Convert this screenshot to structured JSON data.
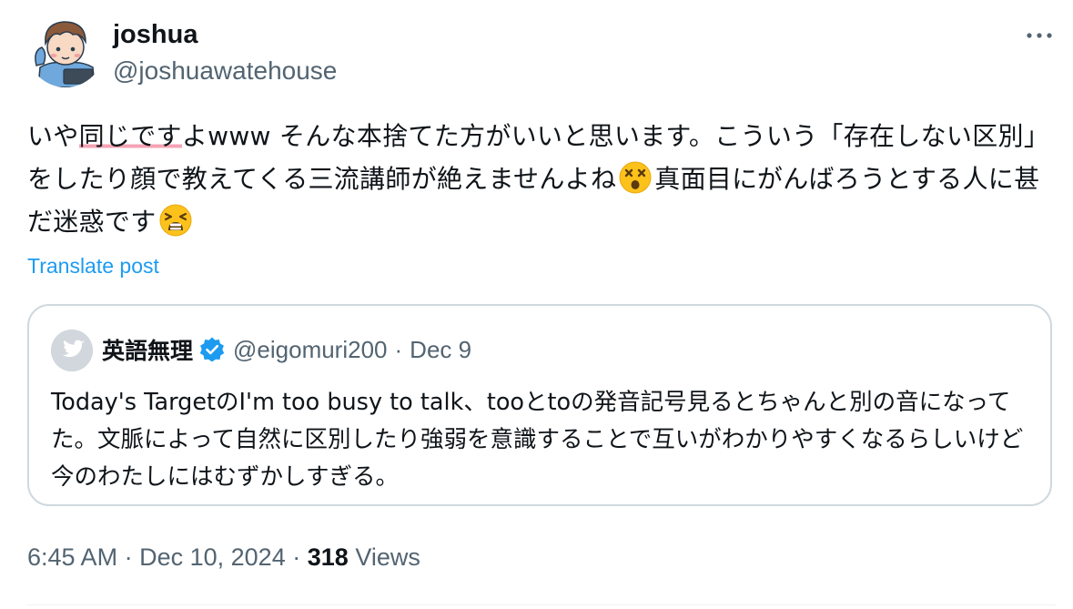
{
  "author": {
    "display_name": "joshua",
    "handle": "@joshuawatehouse",
    "avatar_icon": "cartoon-boy-avatar-icon"
  },
  "more_icon": "more-horizontal-icon",
  "tweet": {
    "text_1": "いや",
    "text_highlight": "同じです",
    "text_2": "よwww そんな本捨てた方がいいと思います。こういう「存在しない区別」をしたり顔で教えてくる三流講師が絶えませんよね",
    "emoji_1": "dizzy-face-emoji",
    "text_3": "真面目にがんばろうとする人に甚だ迷惑です",
    "emoji_2": "weary-face-emoji",
    "highlight_color": "#f4a3b4"
  },
  "translate_label": "Translate post",
  "quote": {
    "name": "英語無理",
    "verified_icon": "verified-badge-icon",
    "handle": "@eigomuri200",
    "separator": "·",
    "date": "Dec 9",
    "text": "Today's TargetのI'm too busy to talk、tooとtoの発音記号見るとちゃんと別の音になってた。文脈によって自然に区別したり強弱を意識することで互いがわかりやすくなるらしいけど今のわたしにはむずかしすぎる。"
  },
  "meta": {
    "time": "6:45 AM",
    "sep1": "·",
    "date": "Dec 10, 2024",
    "sep2": "·",
    "views_count": "318",
    "views_label": "Views"
  },
  "colors": {
    "accent": "#1d9bf0",
    "secondary_text": "#536471",
    "border": "#cfd9de"
  }
}
